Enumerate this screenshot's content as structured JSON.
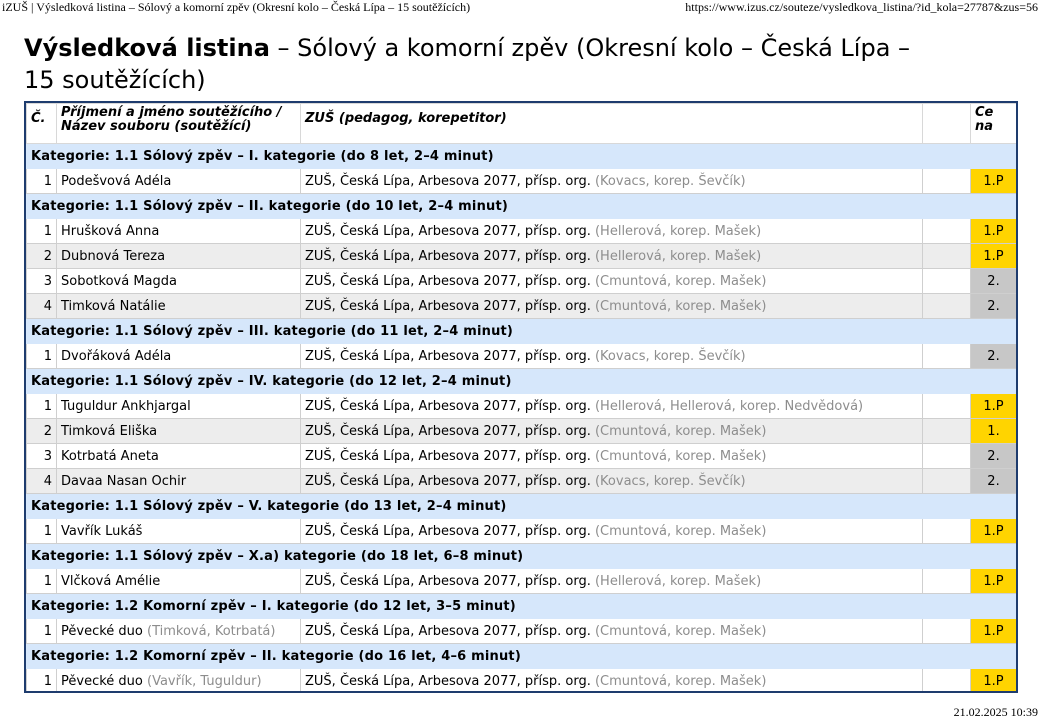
{
  "print_header": {
    "title": "iZUŠ | Výsledková listina – Sólový a komorní zpěv (Okresní kolo – Česká Lípa – 15 soutěžících)",
    "url": "https://www.izus.cz/souteze/vysledkova_listina/?id_kola=27787&zus=56"
  },
  "print_footer": {
    "datetime": "21.02.2025 10:39"
  },
  "heading": {
    "bold": "Výsledková listina",
    "rest": " – Sólový a komorní zpěv (Okresní kolo – Česká Lípa – 15 soutěžících)"
  },
  "table_header": {
    "num": "Č.",
    "name": "Příjmení a jméno soutěžícího / Název souboru (soutěžící)",
    "school": "ZUŠ (pedagog, korepetitor)",
    "prize": "Ce na"
  },
  "categories": [
    {
      "label": "Kategorie: 1.1 Sólový zpěv – I. kategorie (do 8 let, 2–4 minut)",
      "rows": [
        {
          "num": "1",
          "name": "Podešvová Adéla",
          "members": "",
          "school": "ZUŠ, Česká Lípa, Arbesova 2077, přísp. org.",
          "teachers": "(Kovacs, korep. Ševčík)",
          "prize": "1.P",
          "tier": "gold"
        }
      ]
    },
    {
      "label": "Kategorie: 1.1 Sólový zpěv – II. kategorie (do 10 let, 2–4 minut)",
      "rows": [
        {
          "num": "1",
          "name": "Hrušková Anna",
          "members": "",
          "school": "ZUŠ, Česká Lípa, Arbesova 2077, přísp. org.",
          "teachers": "(Hellerová, korep. Mašek)",
          "prize": "1.P",
          "tier": "gold"
        },
        {
          "num": "2",
          "name": "Dubnová Tereza",
          "members": "",
          "school": "ZUŠ, Česká Lípa, Arbesova 2077, přísp. org.",
          "teachers": "(Hellerová, korep. Mašek)",
          "prize": "1.P",
          "tier": "gold"
        },
        {
          "num": "3",
          "name": "Sobotková Magda",
          "members": "",
          "school": "ZUŠ, Česká Lípa, Arbesova 2077, přísp. org.",
          "teachers": "(Cmuntová, korep. Mašek)",
          "prize": "2.",
          "tier": "silver"
        },
        {
          "num": "4",
          "name": "Timková Natálie",
          "members": "",
          "school": "ZUŠ, Česká Lípa, Arbesova 2077, přísp. org.",
          "teachers": "(Cmuntová, korep. Mašek)",
          "prize": "2.",
          "tier": "silver"
        }
      ]
    },
    {
      "label": "Kategorie: 1.1 Sólový zpěv – III. kategorie (do 11 let, 2–4 minut)",
      "rows": [
        {
          "num": "1",
          "name": "Dvořáková Adéla",
          "members": "",
          "school": "ZUŠ, Česká Lípa, Arbesova 2077, přísp. org.",
          "teachers": "(Kovacs, korep. Ševčík)",
          "prize": "2.",
          "tier": "silver"
        }
      ]
    },
    {
      "label": "Kategorie: 1.1 Sólový zpěv – IV. kategorie (do 12 let, 2–4 minut)",
      "rows": [
        {
          "num": "1",
          "name": "Tuguldur Ankhjargal",
          "members": "",
          "school": "ZUŠ, Česká Lípa, Arbesova 2077, přísp. org.",
          "teachers": "(Hellerová, Hellerová, korep. Nedvědová)",
          "prize": "1.P",
          "tier": "gold"
        },
        {
          "num": "2",
          "name": "Timková Eliška",
          "members": "",
          "school": "ZUŠ, Česká Lípa, Arbesova 2077, přísp. org.",
          "teachers": "(Cmuntová, korep. Mašek)",
          "prize": "1.",
          "tier": "gold"
        },
        {
          "num": "3",
          "name": "Kotrbatá Aneta",
          "members": "",
          "school": "ZUŠ, Česká Lípa, Arbesova 2077, přísp. org.",
          "teachers": "(Cmuntová, korep. Mašek)",
          "prize": "2.",
          "tier": "silver"
        },
        {
          "num": "4",
          "name": "Davaa Nasan Ochir",
          "members": "",
          "school": "ZUŠ, Česká Lípa, Arbesova 2077, přísp. org.",
          "teachers": "(Kovacs, korep. Ševčík)",
          "prize": "2.",
          "tier": "silver"
        }
      ]
    },
    {
      "label": "Kategorie: 1.1 Sólový zpěv – V. kategorie (do 13 let, 2–4 minut)",
      "rows": [
        {
          "num": "1",
          "name": "Vavřík Lukáš",
          "members": "",
          "school": "ZUŠ, Česká Lípa, Arbesova 2077, přísp. org.",
          "teachers": "(Cmuntová, korep. Mašek)",
          "prize": "1.P",
          "tier": "gold"
        }
      ]
    },
    {
      "label": "Kategorie: 1.1 Sólový zpěv – X.a) kategorie (do 18 let, 6–8 minut)",
      "rows": [
        {
          "num": "1",
          "name": "Vlčková Amélie",
          "members": "",
          "school": "ZUŠ, Česká Lípa, Arbesova 2077, přísp. org.",
          "teachers": "(Hellerová, korep. Mašek)",
          "prize": "1.P",
          "tier": "gold"
        }
      ]
    },
    {
      "label": "Kategorie: 1.2 Komorní zpěv – I. kategorie (do 12 let, 3–5 minut)",
      "rows": [
        {
          "num": "1",
          "name": "Pěvecké duo",
          "members": "(Timková, Kotrbatá)",
          "school": "ZUŠ, Česká Lípa, Arbesova 2077, přísp. org.",
          "teachers": "(Cmuntová, korep. Mašek)",
          "prize": "1.P",
          "tier": "gold"
        }
      ]
    },
    {
      "label": "Kategorie: 1.2 Komorní zpěv – II. kategorie (do 16 let, 4–6 minut)",
      "rows": [
        {
          "num": "1",
          "name": "Pěvecké duo",
          "members": "(Vavřík, Tuguldur)",
          "school": "ZUŠ, Česká Lípa, Arbesova 2077, přísp. org.",
          "teachers": "(Cmuntová, korep. Mašek)",
          "prize": "1.P",
          "tier": "gold"
        }
      ]
    }
  ],
  "colors": {
    "border": "#1e3c6e",
    "category_bg": "#d6e7fb",
    "gold": "#ffd400",
    "silver": "#c7c7c7",
    "muted_text": "#8d8d8d"
  }
}
